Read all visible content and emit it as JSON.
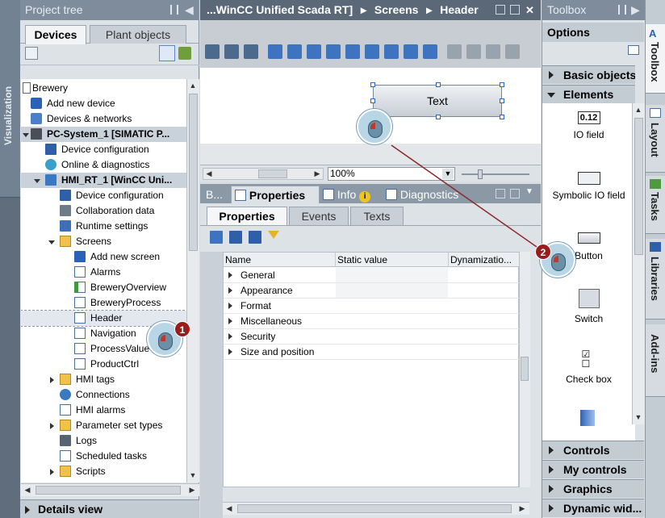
{
  "side_strip": {
    "label": "Visualization"
  },
  "project_tree": {
    "title": "Project tree",
    "tabs": [
      "Devices",
      "Plant objects"
    ],
    "items": [
      {
        "label": "Brewery"
      },
      {
        "label": "Add new device"
      },
      {
        "label": "Devices & networks"
      },
      {
        "label": "PC-System_1 [SIMATIC P..."
      },
      {
        "label": "Device configuration"
      },
      {
        "label": "Online & diagnostics"
      },
      {
        "label": "HMI_RT_1 [WinCC Uni..."
      },
      {
        "label": "Device configuration"
      },
      {
        "label": "Collaboration data"
      },
      {
        "label": "Runtime settings"
      },
      {
        "label": "Screens"
      },
      {
        "label": "Add new screen"
      },
      {
        "label": "Alarms"
      },
      {
        "label": "BreweryOverview"
      },
      {
        "label": "BreweryProcess"
      },
      {
        "label": "Header"
      },
      {
        "label": "Navigation"
      },
      {
        "label": "ProcessValue"
      },
      {
        "label": "ProductCtrl"
      },
      {
        "label": "HMI tags"
      },
      {
        "label": "Connections"
      },
      {
        "label": "HMI alarms"
      },
      {
        "label": "Parameter set types"
      },
      {
        "label": "Logs"
      },
      {
        "label": "Scheduled tasks"
      },
      {
        "label": "Scripts"
      }
    ],
    "details_view": "Details view"
  },
  "editor": {
    "breadcrumb": [
      "...WinCC Unified Scada RT]",
      "Screens",
      "Header"
    ],
    "canvas_button_text": "Text",
    "zoom": "100%"
  },
  "properties_panel": {
    "tabs": {
      "b": "B...",
      "properties": "Properties",
      "info": "Info",
      "info_badge": "i",
      "diagnostics": "Diagnostics"
    },
    "subtabs": [
      "Properties",
      "Events",
      "Texts"
    ],
    "columns": [
      "Name",
      "Static value",
      "Dynamizatio..."
    ],
    "rows": [
      "General",
      "Appearance",
      "Format",
      "Miscellaneous",
      "Security",
      "Size and position"
    ]
  },
  "toolbox": {
    "title": "Toolbox",
    "options": "Options",
    "sections": {
      "basic_objects": "Basic objects",
      "elements": "Elements",
      "controls": "Controls",
      "my_controls": "My controls",
      "graphics": "Graphics",
      "dynamic_widgets": "Dynamic wid..."
    },
    "elements": [
      {
        "label": "IO field",
        "glyph": "0.12"
      },
      {
        "label": "Symbolic IO field"
      },
      {
        "label": "Button"
      },
      {
        "label": "Switch"
      },
      {
        "label": "Check box"
      }
    ]
  },
  "right_tabs": [
    "Toolbox",
    "Layout",
    "Tasks",
    "Libraries",
    "Add-ins"
  ],
  "callouts": [
    "1",
    "2"
  ],
  "colors": {
    "accent": "#2a66c9",
    "badge": "#9b1c1c",
    "header": "#7e8c9c"
  }
}
